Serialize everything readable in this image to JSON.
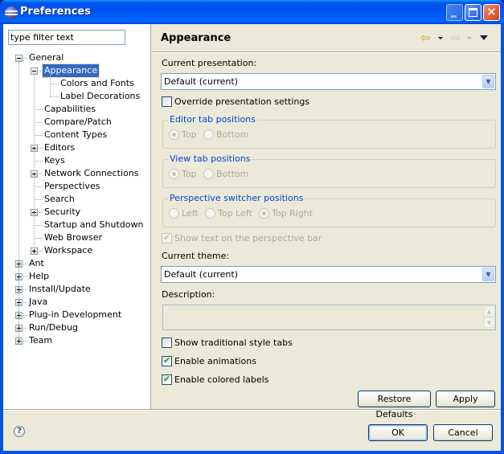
{
  "window": {
    "title": "Preferences",
    "controls": {
      "minimize": "minimize",
      "maximize": "maximize",
      "close": "✕"
    }
  },
  "filter": {
    "value": "type filter text",
    "placeholder": "type filter text"
  },
  "tree": {
    "items": [
      {
        "label": "General",
        "level": 0,
        "expander": "minus"
      },
      {
        "label": "Appearance",
        "level": 1,
        "expander": "minus",
        "selected": true
      },
      {
        "label": "Colors and Fonts",
        "level": 2,
        "expander": "none"
      },
      {
        "label": "Label Decorations",
        "level": 2,
        "expander": "none"
      },
      {
        "label": "Capabilities",
        "level": 1,
        "expander": "none"
      },
      {
        "label": "Compare/Patch",
        "level": 1,
        "expander": "none"
      },
      {
        "label": "Content Types",
        "level": 1,
        "expander": "none"
      },
      {
        "label": "Editors",
        "level": 1,
        "expander": "plus"
      },
      {
        "label": "Keys",
        "level": 1,
        "expander": "none"
      },
      {
        "label": "Network Connections",
        "level": 1,
        "expander": "plus"
      },
      {
        "label": "Perspectives",
        "level": 1,
        "expander": "none"
      },
      {
        "label": "Search",
        "level": 1,
        "expander": "none"
      },
      {
        "label": "Security",
        "level": 1,
        "expander": "plus"
      },
      {
        "label": "Startup and Shutdown",
        "level": 1,
        "expander": "none"
      },
      {
        "label": "Web Browser",
        "level": 1,
        "expander": "none"
      },
      {
        "label": "Workspace",
        "level": 1,
        "expander": "plus"
      },
      {
        "label": "Ant",
        "level": 0,
        "expander": "plus"
      },
      {
        "label": "Help",
        "level": 0,
        "expander": "plus"
      },
      {
        "label": "Install/Update",
        "level": 0,
        "expander": "plus"
      },
      {
        "label": "Java",
        "level": 0,
        "expander": "plus"
      },
      {
        "label": "Plug-in Development",
        "level": 0,
        "expander": "plus"
      },
      {
        "label": "Run/Debug",
        "level": 0,
        "expander": "plus"
      },
      {
        "label": "Team",
        "level": 0,
        "expander": "plus"
      }
    ]
  },
  "page": {
    "title": "Appearance",
    "nav": {
      "back_icon": "⇦",
      "forward_icon": "⇨"
    },
    "current_presentation_label": "Current presentation:",
    "current_presentation_value": "Default (current)",
    "override_label": "Override presentation settings",
    "override_checked": false,
    "editor_tab": {
      "title": "Editor tab positions",
      "options": [
        {
          "label": "Top",
          "selected": true
        },
        {
          "label": "Bottom",
          "selected": false
        }
      ]
    },
    "view_tab": {
      "title": "View tab positions",
      "options": [
        {
          "label": "Top",
          "selected": true
        },
        {
          "label": "Bottom",
          "selected": false
        }
      ]
    },
    "perspective_switcher": {
      "title": "Perspective switcher positions",
      "options": [
        {
          "label": "Left",
          "selected": false
        },
        {
          "label": "Top Left",
          "selected": false
        },
        {
          "label": "Top Right",
          "selected": true
        }
      ]
    },
    "show_text_label": "Show text on the perspective bar",
    "show_text_checked": true,
    "current_theme_label": "Current theme:",
    "current_theme_value": "Default (current)",
    "description_label": "Description:",
    "description_value": "",
    "traditional_tabs_label": "Show traditional style tabs",
    "traditional_tabs_checked": false,
    "animations_label": "Enable animations",
    "animations_checked": true,
    "colored_labels_label": "Enable colored labels",
    "colored_labels_checked": true,
    "restore_defaults_label": "Restore Defaults",
    "apply_label": "Apply"
  },
  "footer": {
    "help_icon": "?",
    "ok_label": "OK",
    "cancel_label": "Cancel"
  }
}
